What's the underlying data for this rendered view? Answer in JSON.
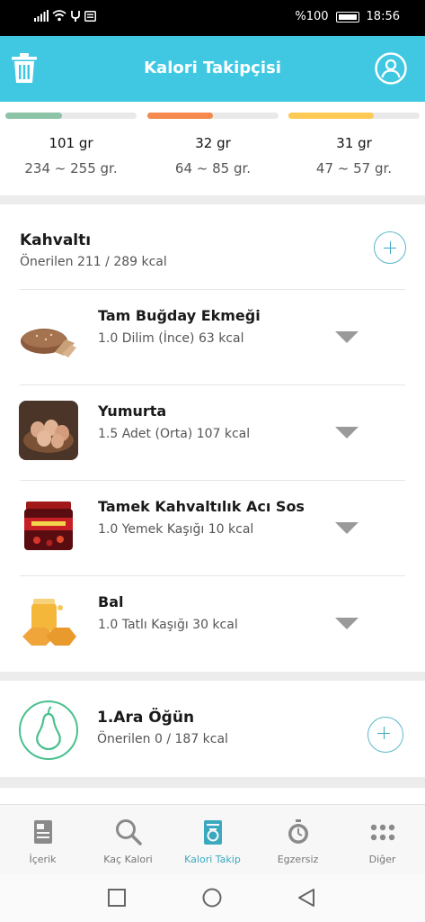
{
  "status": {
    "battery": "%100",
    "time": "18:56"
  },
  "header": {
    "title": "Kalori Takipçisi"
  },
  "macros": [
    {
      "value": "101 gr",
      "range": "234 ~ 255 gr.",
      "progress": 0.43,
      "color": "#8dc3a7"
    },
    {
      "value": "32 gr",
      "range": "64 ~ 85 gr.",
      "progress": 0.5,
      "color": "#f5894e"
    },
    {
      "value": "31 gr",
      "range": "47 ~ 57 gr.",
      "progress": 0.65,
      "color": "#fdcb55"
    }
  ],
  "breakfast": {
    "name": "Kahvaltı",
    "recommended": "Önerilen 211 / 289 kcal",
    "items": [
      {
        "name": "Tam Buğday Ekmeği",
        "detail": "1.0 Dilim (İnce) 63 kcal"
      },
      {
        "name": "Yumurta",
        "detail": "1.5 Adet (Orta) 107 kcal"
      },
      {
        "name": "Tamek Kahvaltılık Acı Sos",
        "detail": "1.0 Yemek Kaşığı 10 kcal"
      },
      {
        "name": "Bal",
        "detail": "1.0 Tatlı Kaşığı 30 kcal"
      }
    ]
  },
  "snack": {
    "name": "1.Ara Öğün",
    "recommended": "Önerilen 0 / 187 kcal"
  },
  "nav": [
    {
      "label": "İçerik",
      "icon": "document-icon"
    },
    {
      "label": "Kaç Kalori",
      "icon": "search-icon"
    },
    {
      "label": "Kalori Takip",
      "icon": "scale-icon",
      "active": true
    },
    {
      "label": "Egzersiz",
      "icon": "stopwatch-icon"
    },
    {
      "label": "Diğer",
      "icon": "more-icon"
    }
  ],
  "colors": {
    "accent": "#40c8e3",
    "snack_icon": "#49c08e"
  }
}
